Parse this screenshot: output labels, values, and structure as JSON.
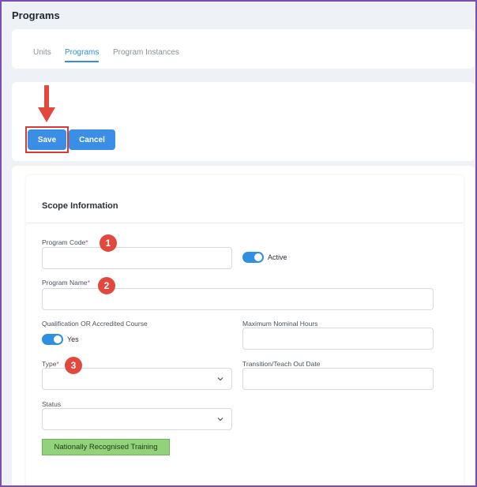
{
  "page": {
    "title": "Programs"
  },
  "tabs": [
    {
      "label": "Units"
    },
    {
      "label": "Programs",
      "active": true
    },
    {
      "label": "Program Instances"
    }
  ],
  "actions": {
    "save_label": "Save",
    "cancel_label": "Cancel"
  },
  "form": {
    "section_title": "Scope Information",
    "program_code": {
      "label": "Program Code",
      "required_mark": "*",
      "value": ""
    },
    "active_toggle": {
      "label": "Active",
      "on": true
    },
    "program_name": {
      "label": "Program Name",
      "required_mark": "*",
      "value": ""
    },
    "qualification": {
      "label": "Qualification OR Accredited Course",
      "toggle_label": "Yes",
      "on": true
    },
    "max_nominal_hours": {
      "label": "Maximum Nominal Hours",
      "value": ""
    },
    "type": {
      "label": "Type",
      "required_mark": "*",
      "selected": ""
    },
    "transition_date": {
      "label": "Transition/Teach Out Date",
      "value": ""
    },
    "status": {
      "label": "Status",
      "selected": ""
    },
    "nrt_badge": "Nationally Recognised Training"
  },
  "callouts": [
    "1",
    "2",
    "3"
  ],
  "colors": {
    "accent": "#2f8fe0",
    "button": "#3b8ee6",
    "callout": "#e2493e",
    "nrt_badge": "#92d27a",
    "frame": "#7b4fb0"
  }
}
